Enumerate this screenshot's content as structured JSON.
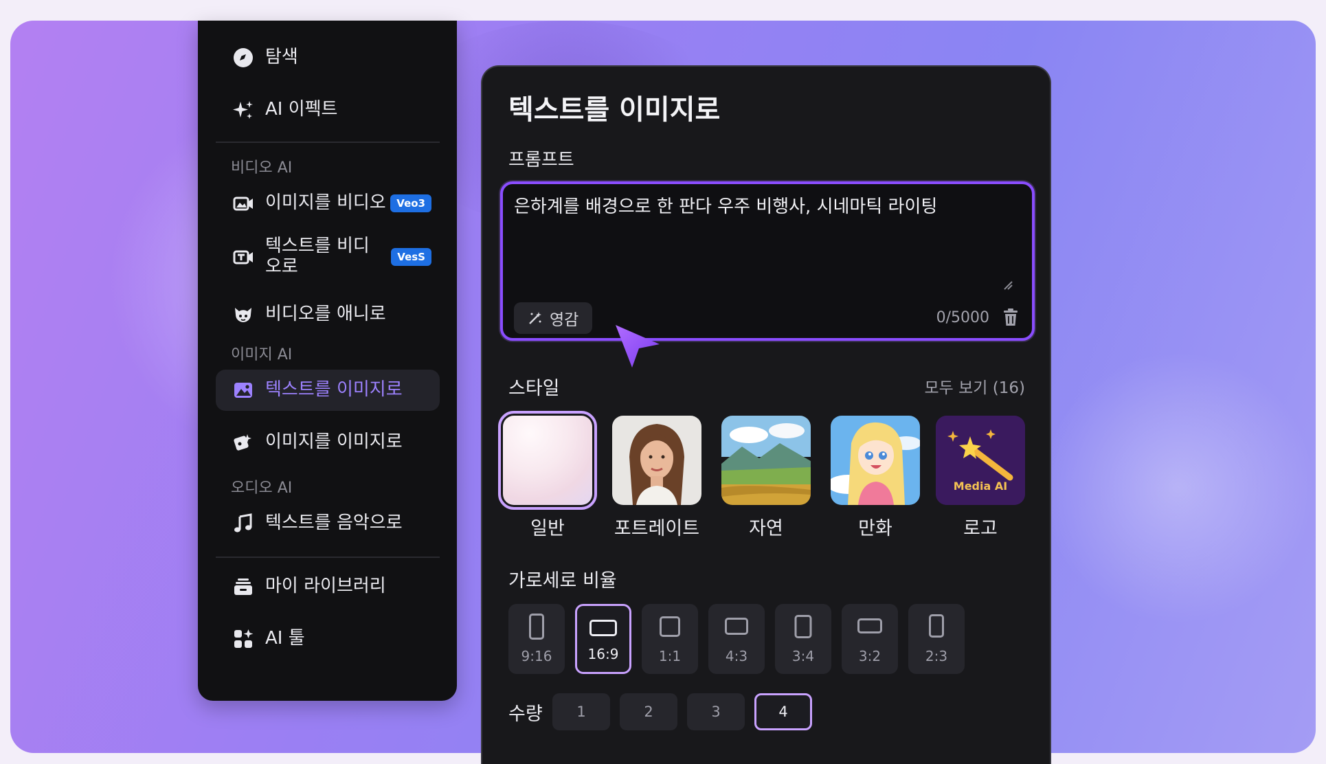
{
  "sidebar": {
    "explore": "탐색",
    "ai_effects": "AI 이펙트",
    "video_ai_header": "비디오 AI",
    "image_to_video": "이미지를 비디오",
    "image_to_video_badge": "Veo3",
    "text_to_video": "텍스트를 비디오로",
    "text_to_video_badge": "VesS",
    "video_to_anime": "비디오를 애니로",
    "image_ai_header": "이미지 AI",
    "text_to_image": "텍스트를 이미지로",
    "image_to_image": "이미지를 이미지로",
    "audio_ai_header": "오디오 AI",
    "text_to_music": "텍스트를 음악으로",
    "my_library": "마이 라이브러리",
    "ai_tools": "AI 툴"
  },
  "panel": {
    "title": "텍스트를 이미지로",
    "prompt_label": "프롬프트",
    "prompt_value": "은하계를 배경으로 한 판다 우주 비행사, 시네마틱 라이팅",
    "inspire_label": "영감",
    "char_count": "0/5000",
    "style_label": "스타일",
    "see_all": "모두 보기 (16)",
    "styles": [
      "일반",
      "포트레이트",
      "자연",
      "만화",
      "로고"
    ],
    "logo_card_text": "Media AI",
    "ratio_label": "가로세로 비율",
    "ratios": [
      "9:16",
      "16:9",
      "1:1",
      "4:3",
      "3:4",
      "3:2",
      "2:3"
    ],
    "selected_ratio": "16:9",
    "quantity_label": "수량",
    "quantities": [
      "1",
      "2",
      "3",
      "4"
    ],
    "selected_quantity": "4"
  },
  "colors": {
    "accent": "#8a4dff",
    "selected_outline": "#c9a2ff",
    "badge_blue": "#1e6fe3",
    "active_text": "#9d82ff"
  },
  "icons": {
    "explore": "compass-icon",
    "ai_effects": "sparkle-icon",
    "image_to_video": "image-video-icon",
    "text_to_video": "text-video-icon",
    "video_to_anime": "anime-face-icon",
    "text_to_image": "image-icon",
    "image_to_image": "image-transform-icon",
    "text_to_music": "music-note-icon",
    "my_library": "library-icon",
    "ai_tools": "grid-tools-icon"
  }
}
